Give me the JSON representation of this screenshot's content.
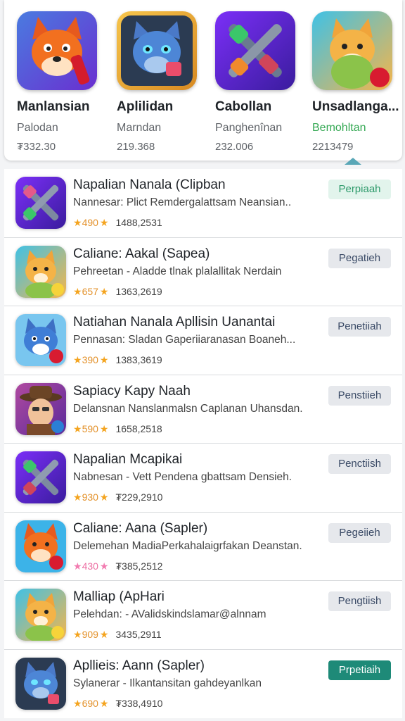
{
  "featured": [
    {
      "name": "Manlansian",
      "subtitle": "Palodan",
      "count": "₮332.30",
      "icon": "fox-character-icon"
    },
    {
      "name": "Aplilidan",
      "subtitle": "Marndan",
      "count": "219.368",
      "icon": "blue-cat-character-icon"
    },
    {
      "name": "Cabollan",
      "subtitle": "Panghenînan",
      "count": "232.006",
      "icon": "crossed-weapons-icon"
    },
    {
      "name": "Unsadlanga...",
      "subtitle": "Bemohltan",
      "count": "2213479",
      "icon": "orange-cat-character-icon"
    }
  ],
  "list": [
    {
      "title": "Napalian Nanala (Clipban",
      "desc": "Nannesar: Plict Remdergalattsam Neansian..",
      "rating": "490",
      "count": "1488,2531",
      "action": "Perpiaah",
      "icon": "crossed-weapons-icon"
    },
    {
      "title": "Caliane: Aakal (Sapea)",
      "desc": "Pehreetan - Aladde tlnak plalallitak Nerdain",
      "rating": "657",
      "count": "1363,2619",
      "action": "Pegatieh",
      "icon": "orange-cat-character-icon"
    },
    {
      "title": "Natiahan Nanala Apllisin Uanantai",
      "desc": "Pennasan: Sladan Gaperiiaranasan Boaneh...",
      "rating": "390",
      "count": "1383,3619",
      "action": "Penetiiah",
      "icon": "blue-cat-character-icon"
    },
    {
      "title": "Sapiacy Kapy Naah",
      "desc": "Delansnan Nanslanmalsn Caplanan Uhansdan.",
      "rating": "590",
      "count": "1658,2518",
      "action": "Penstiieh",
      "icon": "cowboy-character-icon"
    },
    {
      "title": "Napalian Mcapikai",
      "desc": "Nabnesan - Vett Pendena gbattsam Densieh.",
      "rating": "930",
      "count": "₮229,2910",
      "action": "Penctiish",
      "icon": "crossed-weapons-icon"
    },
    {
      "title": "Caliane: Aana (Sapler)",
      "desc": "Delemehan MadiaPerkahalaigrfakan Deanstan.",
      "rating": "430",
      "count": "₮385,2512",
      "action": "Pegeiieh",
      "icon": "fox-character-icon"
    },
    {
      "title": "Malliap (ApHari",
      "desc": "Pelehdan: - AValidskindslamar@alnnam",
      "rating": "909",
      "count": "3435,2911",
      "action": "Pengtiish",
      "icon": "orange-cat-character-icon"
    },
    {
      "title": "Apllieis: Aann (Sapler)",
      "desc": "Sylanerar - Ilkantansitan gahdeyanlkan",
      "rating": "690",
      "count": "₮338,4910",
      "action": "Prpetiaih",
      "icon": "blue-cat-character-icon"
    }
  ],
  "colors": {
    "rating_star": "#f4a41f",
    "rating_star_pink": "#f27bb0",
    "action_mint": "#e2f4ec",
    "action_teal": "#1e8a78",
    "action_gray": "#e6e8ec"
  }
}
